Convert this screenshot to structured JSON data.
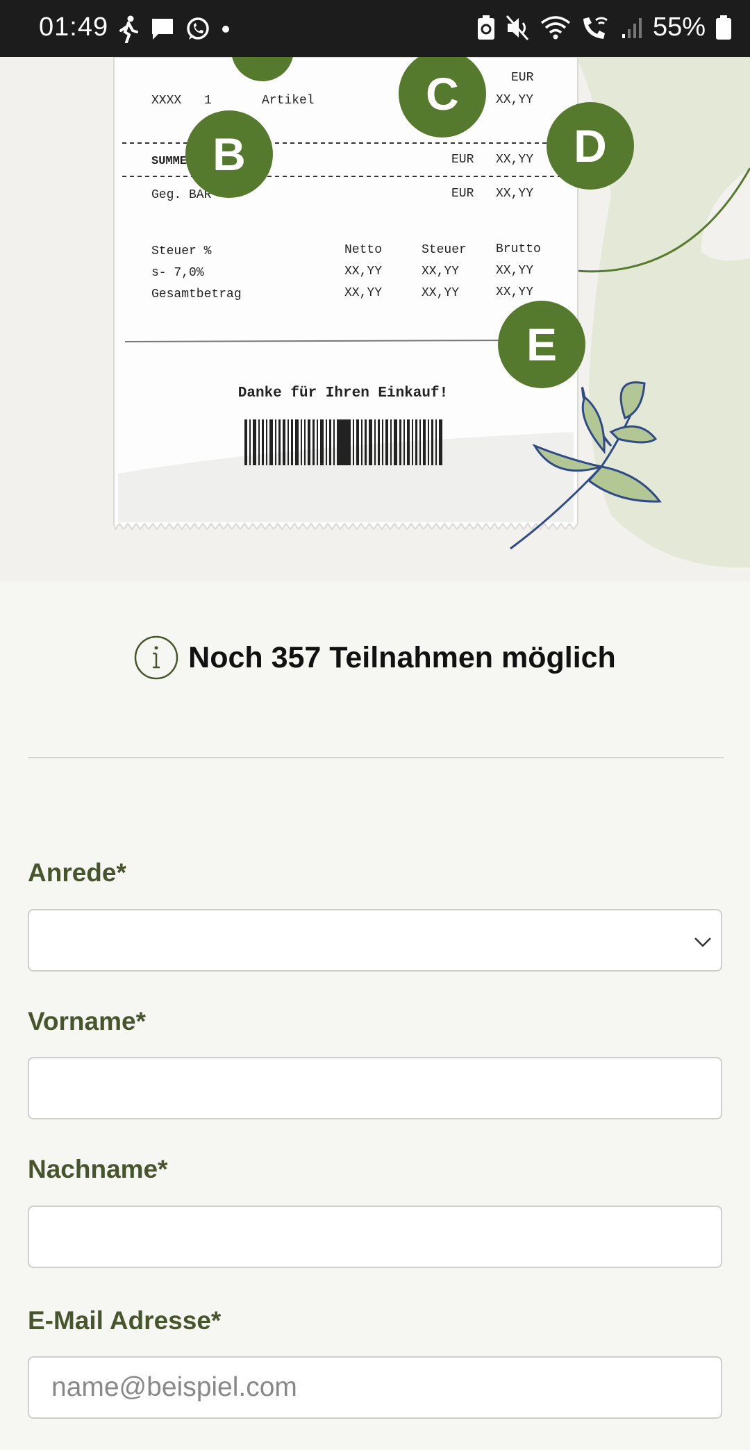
{
  "status_bar": {
    "time": "01:49",
    "left_icons": [
      "walking-icon",
      "message-icon",
      "whatsapp-icon",
      "dot-icon"
    ],
    "right_icons": [
      "battery-saver-icon",
      "mute-icon",
      "wifi-icon",
      "wifi-call-icon",
      "signal-icon",
      "battery-icon"
    ],
    "battery": "55%"
  },
  "receipt": {
    "row1_currency": "EUR",
    "item_code": "XXXX",
    "item_qty": "1",
    "item_label": "Artikel",
    "item_value": "XX,YY",
    "sum_label": "SUMME",
    "sum_currency": "EUR",
    "sum_value": "XX,YY",
    "paid_label": "Geg. BAR",
    "paid_currency": "EUR",
    "paid_value": "XX,YY",
    "tax_header": [
      "Steuer %",
      "Netto",
      "Steuer",
      "Brutto"
    ],
    "tax_row": [
      "s- 7,0%",
      "XX,YY",
      "XX,YY",
      "XX,YY"
    ],
    "total_row": [
      "Gesamtbetrag",
      "XX,YY",
      "XX,YY",
      "XX,YY"
    ],
    "thanks": "Danke für Ihren Einkauf!",
    "markers": [
      "B",
      "C",
      "D",
      "E"
    ],
    "accent_color": "#567a2d"
  },
  "info": {
    "text": "Noch 357 Teilnahmen möglich",
    "icon": "info-icon"
  },
  "form": {
    "salutation": {
      "label": "Anrede*",
      "value": ""
    },
    "first_name": {
      "label": "Vorname*",
      "value": ""
    },
    "last_name": {
      "label": "Nachname*",
      "value": ""
    },
    "email": {
      "label": "E-Mail Adresse*",
      "placeholder": "name@beispiel.com"
    }
  }
}
